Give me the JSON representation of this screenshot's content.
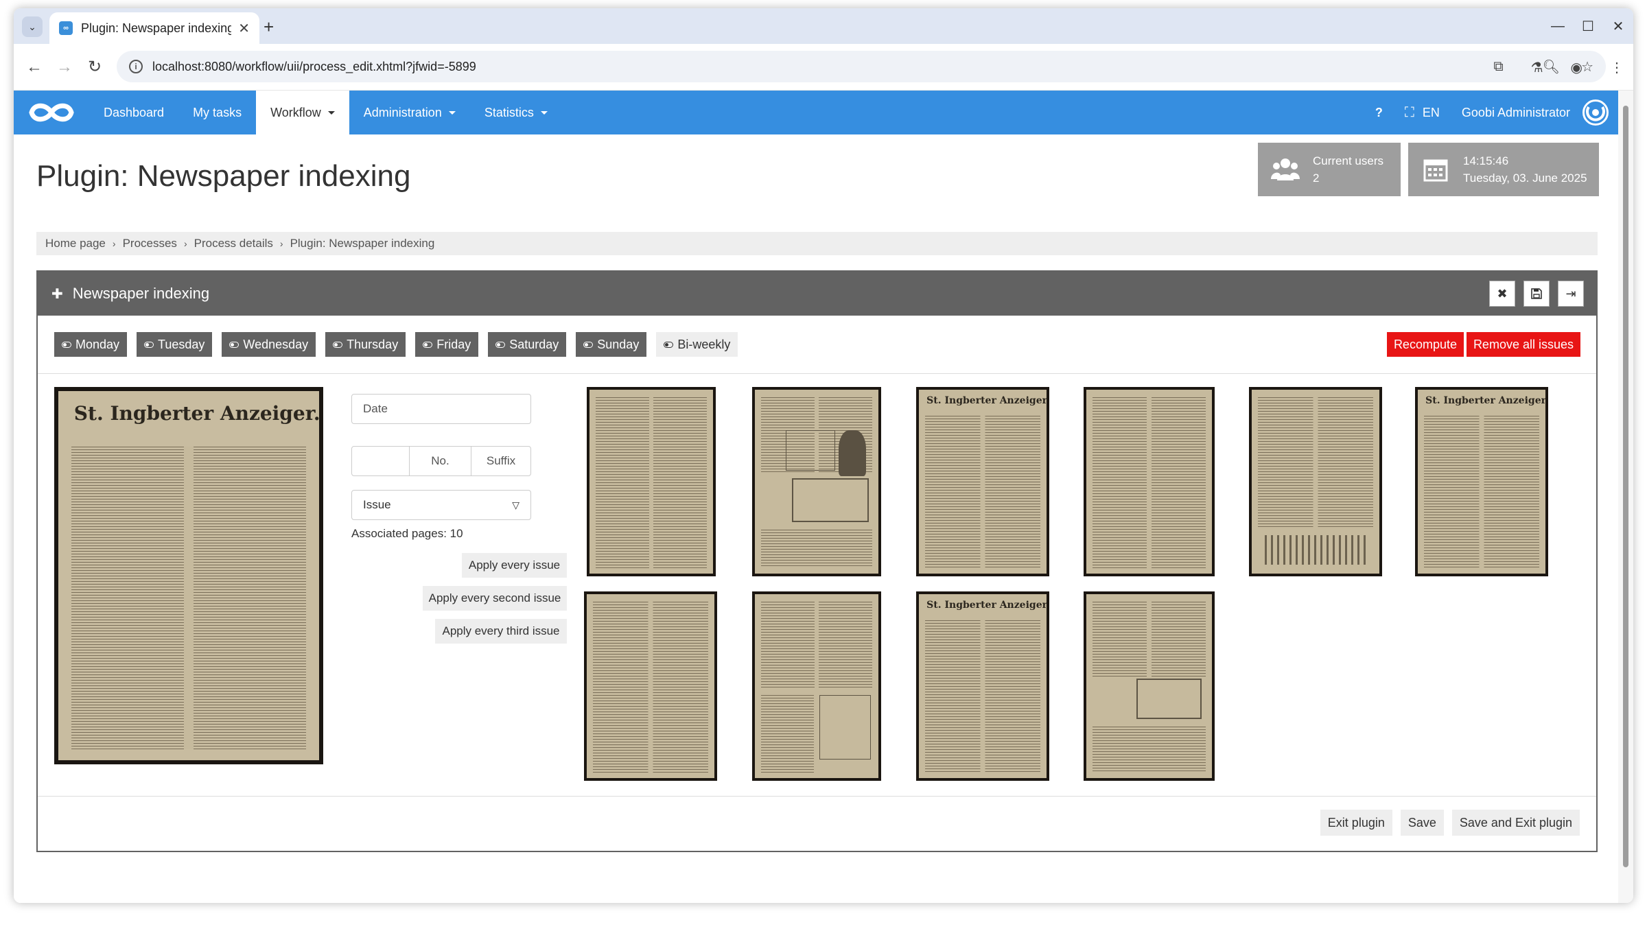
{
  "browser": {
    "tab_title": "Plugin: Newspaper indexing",
    "url": "localhost:8080/workflow/uii/process_edit.xhtml?jfwid=-5899"
  },
  "navbar": {
    "items": [
      "Dashboard",
      "My tasks",
      "Workflow",
      "Administration",
      "Statistics"
    ],
    "active": "Workflow",
    "help": "?",
    "language": "EN",
    "user": "Goobi Administrator"
  },
  "page": {
    "title": "Plugin: Newspaper indexing",
    "users_widget": {
      "label": "Current users",
      "count": "2"
    },
    "clock_widget": {
      "time": "14:15:46",
      "date": "Tuesday, 03. June 2025"
    },
    "breadcrumb": [
      "Home page",
      "Processes",
      "Process details",
      "Plugin: Newspaper indexing"
    ]
  },
  "plugin": {
    "title": "Newspaper indexing",
    "days": [
      {
        "label": "Monday",
        "active": true
      },
      {
        "label": "Tuesday",
        "active": true
      },
      {
        "label": "Wednesday",
        "active": true
      },
      {
        "label": "Thursday",
        "active": true
      },
      {
        "label": "Friday",
        "active": true
      },
      {
        "label": "Saturday",
        "active": true
      },
      {
        "label": "Sunday",
        "active": true
      },
      {
        "label": "Bi-weekly",
        "active": false
      }
    ],
    "recompute": "Recompute",
    "remove_all": "Remove all issues",
    "form": {
      "date_placeholder": "Date",
      "number_placeholder": "No.",
      "suffix_placeholder": "Suffix",
      "type_value": "Issue",
      "associated_pages": "Associated pages: 10",
      "apply_every": "Apply every issue",
      "apply_second": "Apply every second issue",
      "apply_third": "Apply every third issue"
    },
    "masthead_text": "St. Ingberter Anzeiger.",
    "page_count": 10,
    "footer": {
      "exit": "Exit plugin",
      "save": "Save",
      "save_exit": "Save and Exit plugin"
    }
  },
  "colors": {
    "brand": "#368ee0",
    "header_grey": "#626262",
    "danger": "#e81515",
    "widget_grey": "#9e9e9e"
  }
}
